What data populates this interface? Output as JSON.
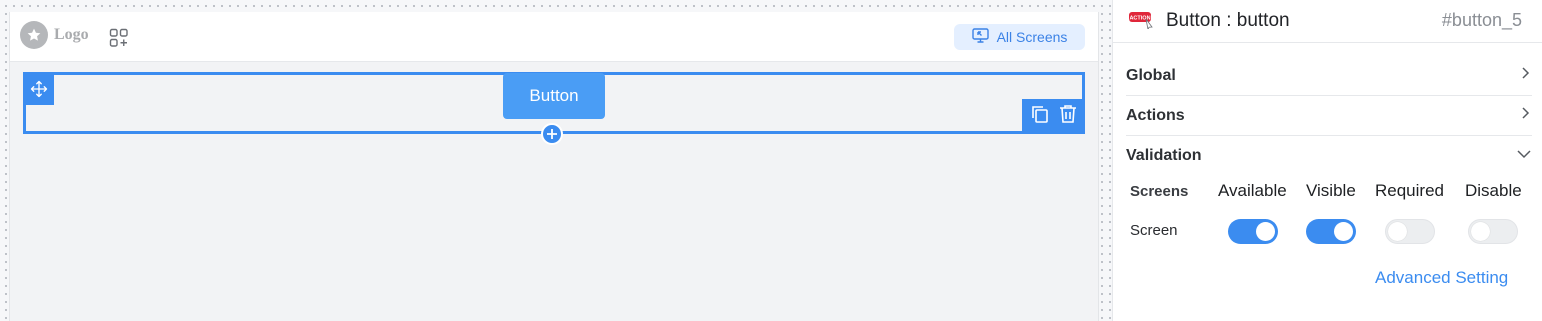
{
  "canvas": {
    "logo_text": "Logo",
    "all_screens_label": "All Screens",
    "button_preview_label": "Button"
  },
  "panel": {
    "title": "Button : button",
    "component_id": "#button_5",
    "component_badge_text": "ACTION",
    "sections": [
      {
        "label": "Global",
        "expanded": false
      },
      {
        "label": "Actions",
        "expanded": false
      },
      {
        "label": "Validation",
        "expanded": true
      }
    ],
    "validation": {
      "columns": [
        "Screens",
        "Available",
        "Visible",
        "Required",
        "Disable"
      ],
      "rows": [
        {
          "label": "Screen",
          "available": true,
          "visible": true,
          "required": false,
          "disable": false
        }
      ]
    },
    "advanced_link": "Advanced Setting"
  },
  "colors": {
    "accent": "#3b8cf0",
    "button_fill": "#4a9df5",
    "chip_bg": "#e4efff",
    "badge_red": "#e0263a"
  },
  "icons": [
    "star-icon",
    "apps-add-icon",
    "screen-icon",
    "move-icon",
    "copy-icon",
    "trash-icon",
    "plus-icon",
    "chevron-right-icon",
    "chevron-down-icon",
    "action-badge-icon"
  ]
}
